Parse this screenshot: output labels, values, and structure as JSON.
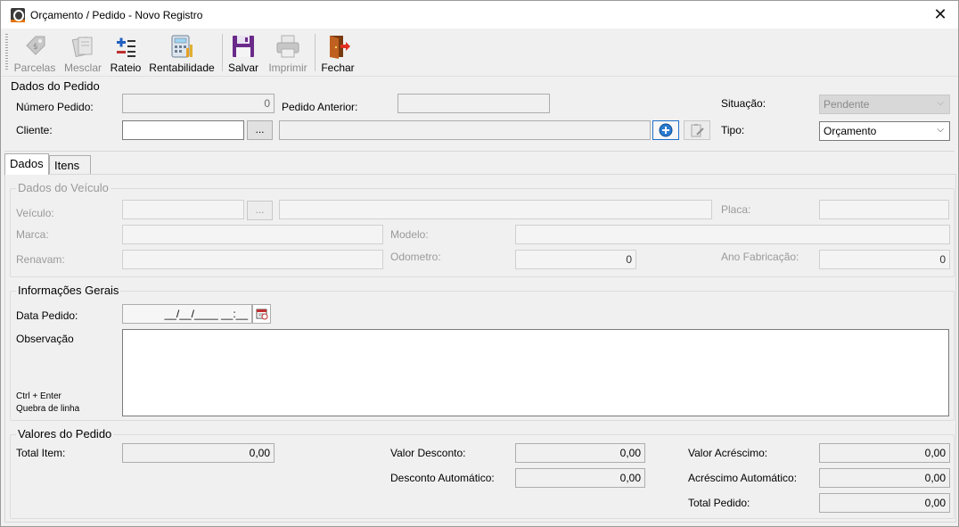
{
  "window": {
    "title": "Orçamento / Pedido - Novo Registro",
    "close_glyph": "✕"
  },
  "toolbar": {
    "buttons": [
      {
        "label": "Parcelas",
        "icon": "price-tag-icon",
        "enabled": false
      },
      {
        "label": "Mesclar",
        "icon": "merge-documents-icon",
        "enabled": false
      },
      {
        "label": "Rateio",
        "icon": "plus-minus-icon",
        "enabled": true
      },
      {
        "label": "Rentabilidade",
        "icon": "calculator-icon",
        "enabled": true
      },
      {
        "label": "Salvar",
        "icon": "floppy-disk-icon",
        "enabled": true
      },
      {
        "label": "Imprimir",
        "icon": "printer-icon",
        "enabled": false
      },
      {
        "label": "Fechar",
        "icon": "exit-door-icon",
        "enabled": true
      }
    ]
  },
  "dados_pedido": {
    "section_title": "Dados do Pedido",
    "numero_pedido_label": "Número Pedido:",
    "numero_pedido_value": "0",
    "pedido_anterior_label": "Pedido Anterior:",
    "pedido_anterior_value": "",
    "situacao_label": "Situação:",
    "situacao_value": "Pendente",
    "cliente_label": "Cliente:",
    "cliente_code_value": "",
    "cliente_lookup_label": "...",
    "cliente_name_value": "",
    "tipo_label": "Tipo:",
    "tipo_value": "Orçamento"
  },
  "tabs": [
    {
      "label": "Dados",
      "active": true
    },
    {
      "label": "Itens",
      "active": false
    }
  ],
  "dados_veiculo": {
    "title": "Dados do Veículo",
    "veiculo_label": "Veículo:",
    "veiculo_lookup_label": "...",
    "placa_label": "Placa:",
    "marca_label": "Marca:",
    "modelo_label": "Modelo:",
    "renavam_label": "Renavam:",
    "odometro_label": "Odometro:",
    "odometro_value": "0",
    "ano_fabricacao_label": "Ano Fabricação:",
    "ano_fabricacao_value": "0"
  },
  "informacoes_gerais": {
    "title": "Informações Gerais",
    "data_pedido_label": "Data Pedido:",
    "data_pedido_mask": "__/__/____ __:__",
    "observacao_label": "Observação",
    "hint_line1": "Ctrl + Enter",
    "hint_line2": "Quebra de linha"
  },
  "valores_pedido": {
    "title": "Valores do Pedido",
    "total_item_label": "Total Item:",
    "total_item_value": "0,00",
    "valor_desconto_label": "Valor Desconto:",
    "valor_desconto_value": "0,00",
    "desconto_automatico_label": "Desconto Automático:",
    "desconto_automatico_value": "0,00",
    "valor_acrescimo_label": "Valor Acréscimo:",
    "valor_acrescimo_value": "0,00",
    "acrescimo_automatico_label": "Acréscimo Automático:",
    "acrescimo_automatico_value": "0,00",
    "total_pedido_label": "Total Pedido:",
    "total_pedido_value": "0,00"
  }
}
